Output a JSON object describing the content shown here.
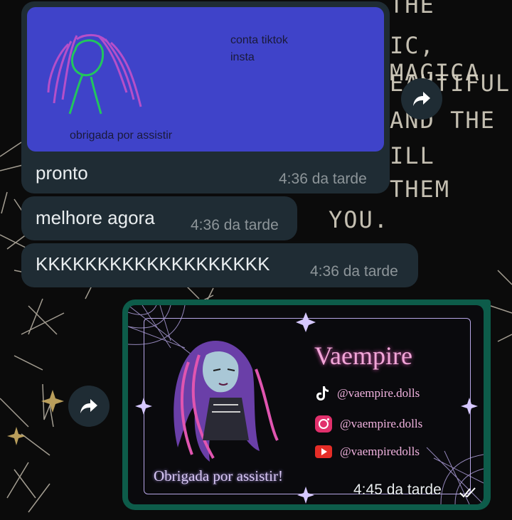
{
  "wallpaper": {
    "lines": [
      "THE",
      "IC, MAGICA",
      "EAUTIFUL",
      "AND THE",
      "ILL",
      "THEM",
      "YOU."
    ]
  },
  "messages": [
    {
      "type": "image",
      "drawing_texts": [
        "conta tiktok",
        "insta",
        "obrigada por assistir"
      ],
      "text": "pronto",
      "time": "4:36 da tarde"
    },
    {
      "type": "text",
      "text": "melhore agora",
      "time": "4:36 da tarde"
    },
    {
      "type": "text",
      "text": "KKKKKKKKKKKKKKKKKKK",
      "time": "4:36 da tarde"
    }
  ],
  "outgoing": {
    "card": {
      "brand": "Vaempire",
      "socials": [
        {
          "icon": "tiktok-icon",
          "handle": "@vaempire.dolls",
          "color": "#ffffff"
        },
        {
          "icon": "instagram-icon",
          "handle": "@vaempire.dolls",
          "color": "#e1306c"
        },
        {
          "icon": "youtube-icon",
          "handle": "@vaempiredolls",
          "color": "#e52d27"
        }
      ],
      "thanks": "Obrigada por assistir!"
    },
    "time": "4:45 da tarde",
    "status_icon": "double-check-icon"
  },
  "colors": {
    "incoming_bubble": "#1f2c34",
    "outgoing_bubble": "#0d5c4a",
    "drawing_bg": "#3f43c9"
  }
}
